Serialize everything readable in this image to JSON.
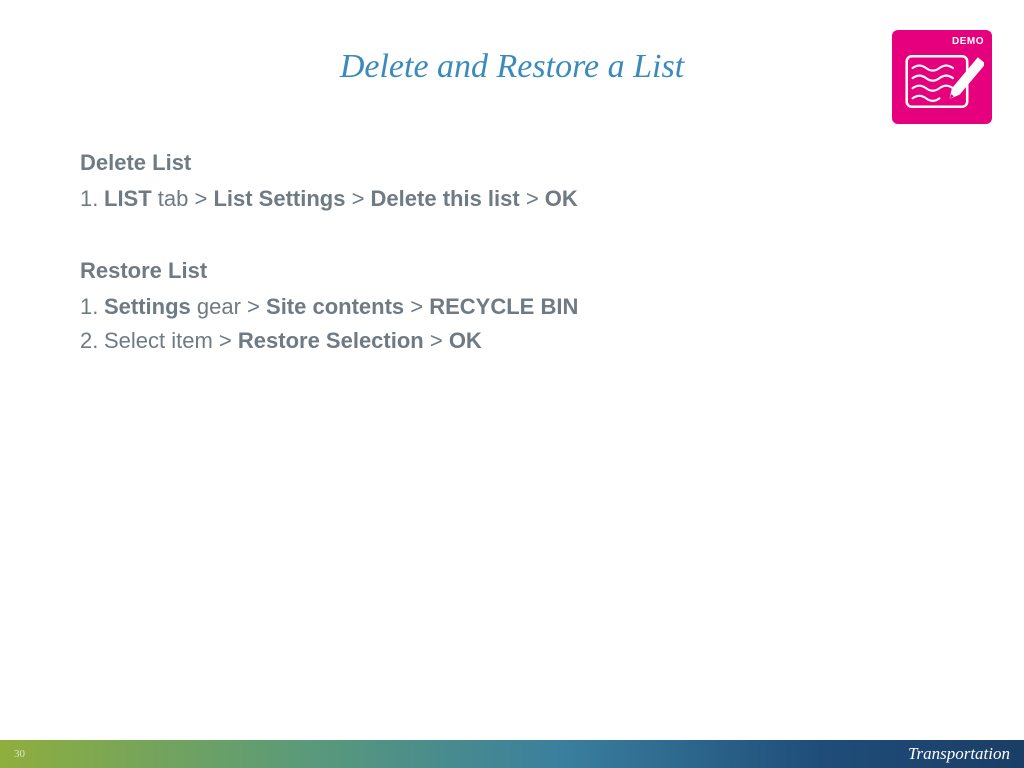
{
  "title": "Delete and Restore a List",
  "badge": {
    "label": "DEMO"
  },
  "sections": {
    "delete": {
      "heading": "Delete List",
      "step1": {
        "num": "1.",
        "p1": "LIST",
        "p2": " tab > ",
        "p3": "List Settings",
        "p4": " > ",
        "p5": "Delete this list",
        "p6": " > ",
        "p7": "OK"
      }
    },
    "restore": {
      "heading": "Restore List",
      "step1": {
        "num": "1.",
        "p1": "Settings",
        "p2": " gear > ",
        "p3": "Site contents",
        "p4": " > ",
        "p5": "RECYCLE BIN"
      },
      "step2": {
        "num": "2.",
        "p1": "Select item > ",
        "p2": "Restore Selection",
        "p3": " > ",
        "p4": "OK"
      }
    }
  },
  "footer": {
    "page": "30",
    "brand": "Transportation"
  }
}
